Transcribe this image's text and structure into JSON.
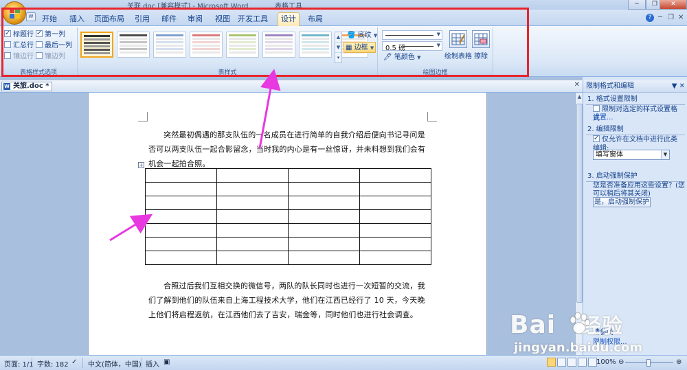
{
  "window": {
    "title": "关联.doc [兼容模式] - Microsoft Word",
    "context_tab_label": "表格工具"
  },
  "ribbon_tabs": [
    "开始",
    "插入",
    "页面布局",
    "引用",
    "邮件",
    "审阅",
    "视图",
    "开发工具",
    "设计",
    "布局"
  ],
  "active_tab": "设计",
  "ribbon": {
    "style_options": {
      "label": "表格样式选项",
      "items": [
        {
          "label": "标题行",
          "checked": true,
          "enabled": true
        },
        {
          "label": "第一列",
          "checked": true,
          "enabled": true
        },
        {
          "label": "汇总行",
          "checked": false,
          "enabled": true
        },
        {
          "label": "最后一列",
          "checked": false,
          "enabled": true
        },
        {
          "label": "镶边行",
          "checked": false,
          "enabled": false
        },
        {
          "label": "镶边列",
          "checked": false,
          "enabled": false
        }
      ]
    },
    "table_styles": {
      "label": "表样式",
      "tile_colors": [
        "#6b6b6b",
        "#4a4a4a",
        "#7f9fd0",
        "#d97b7b",
        "#a8c46e",
        "#9b86c2",
        "#6fb7c9",
        "#f0a65a"
      ],
      "shading_label": "底纹",
      "border_label": "边框"
    },
    "draw_borders": {
      "label": "绘图边框",
      "weight": "0.5 磅",
      "pen_color_label": "笔颜色",
      "draw_table_label": "绘制表格",
      "eraser_label": "擦除"
    }
  },
  "document": {
    "tab_name": "关旅.doc *",
    "paragraph1": "突然最初偶遇的那支队伍的一名成员在进行简单的自我介绍后便向书记寻问是否可以两支队伍一起合影留念，当时我的内心是有一丝惊讶，并未料想到我们会有机会一起拍合照。",
    "paragraph2": "合照过后我们互相交换的微信号，两队的队长同时也进行一次短暂的交流，我们了解到他们的队伍来自上海工程技术大学，他们在江西已经行了 10 天，今天晚上他们将启程返航，在江西他们去了吉安，瑞金等，同时他们也进行社会调查。",
    "table": {
      "rows": 7,
      "cols": 4
    }
  },
  "task_pane": {
    "title": "限制格式和编辑",
    "section1_heading": "1. 格式设置限制",
    "section1_checkbox": "限制对选定的样式设置格式",
    "section1_link": "设置...",
    "section2_heading": "2. 编辑限制",
    "section2_checkbox": "仅允许在文档中进行此类编辑:",
    "section2_select": "填写窗体",
    "section3_heading": "3. 启动强制保护",
    "section3_question": "您是否准备应用这些设置？(您可以稍后将其关闭)",
    "section3_button": "是，启动强制保护",
    "bottom_text": "请参阅",
    "bottom_link": "限制权限..."
  },
  "status_bar": {
    "page": "页面: 1/1",
    "words": "字数: 182",
    "language": "中文(简体，中国)",
    "mode": "插入",
    "zoom": "100%"
  },
  "watermark": {
    "brand": "Bai",
    "brand_suffix": "经验",
    "url": "jingyan.baidu.com"
  },
  "colors": {
    "highlight_box": "#e8242c",
    "arrow": "#e838e0"
  }
}
